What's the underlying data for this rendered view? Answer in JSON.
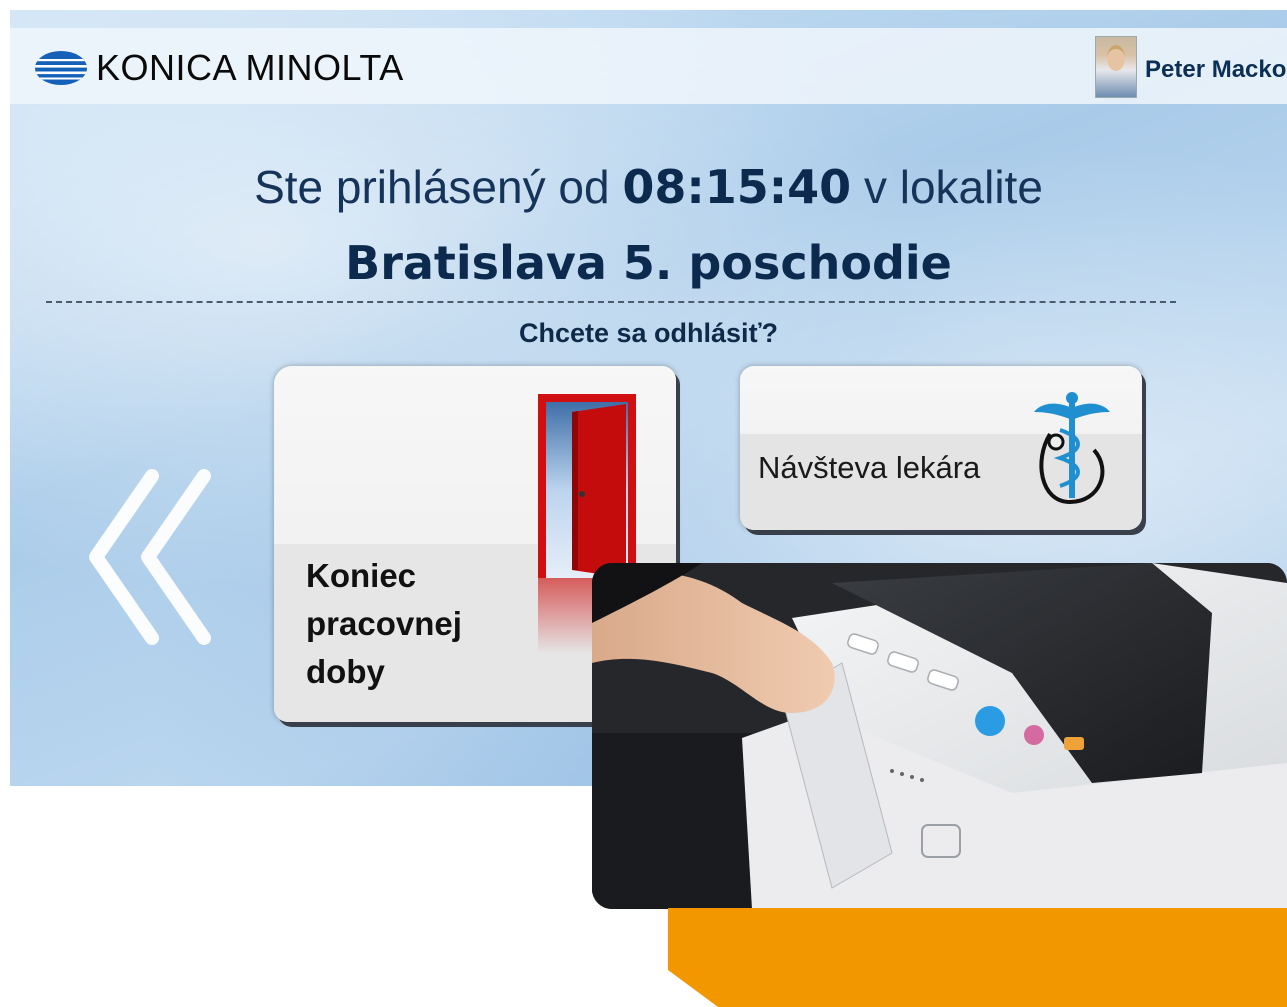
{
  "brand": {
    "logo_text": "KONICA MINOLTA"
  },
  "user": {
    "name": "Peter Macko"
  },
  "session": {
    "prefix": "Ste prihlásený od",
    "time": "08:15:40",
    "suffix": "v lokalite",
    "location": "Bratislava 5. poschodie"
  },
  "prompt": {
    "question": "Chcete sa odhlásiť?"
  },
  "tiles": {
    "end_of_work": {
      "label": "Koniec\npracovnej\ndoby",
      "icon": "open-door-icon"
    },
    "doctor_visit": {
      "label": "Návšteva lekára",
      "icon": "caduceus-stethoscope-icon"
    }
  },
  "nav": {
    "back_icon": "double-chevron-left-icon"
  },
  "colors": {
    "heading_navy": "#0b2a4d",
    "accent_orange": "#f29700",
    "door_red": "#d01010",
    "caduceus_blue": "#1f8fd0"
  }
}
